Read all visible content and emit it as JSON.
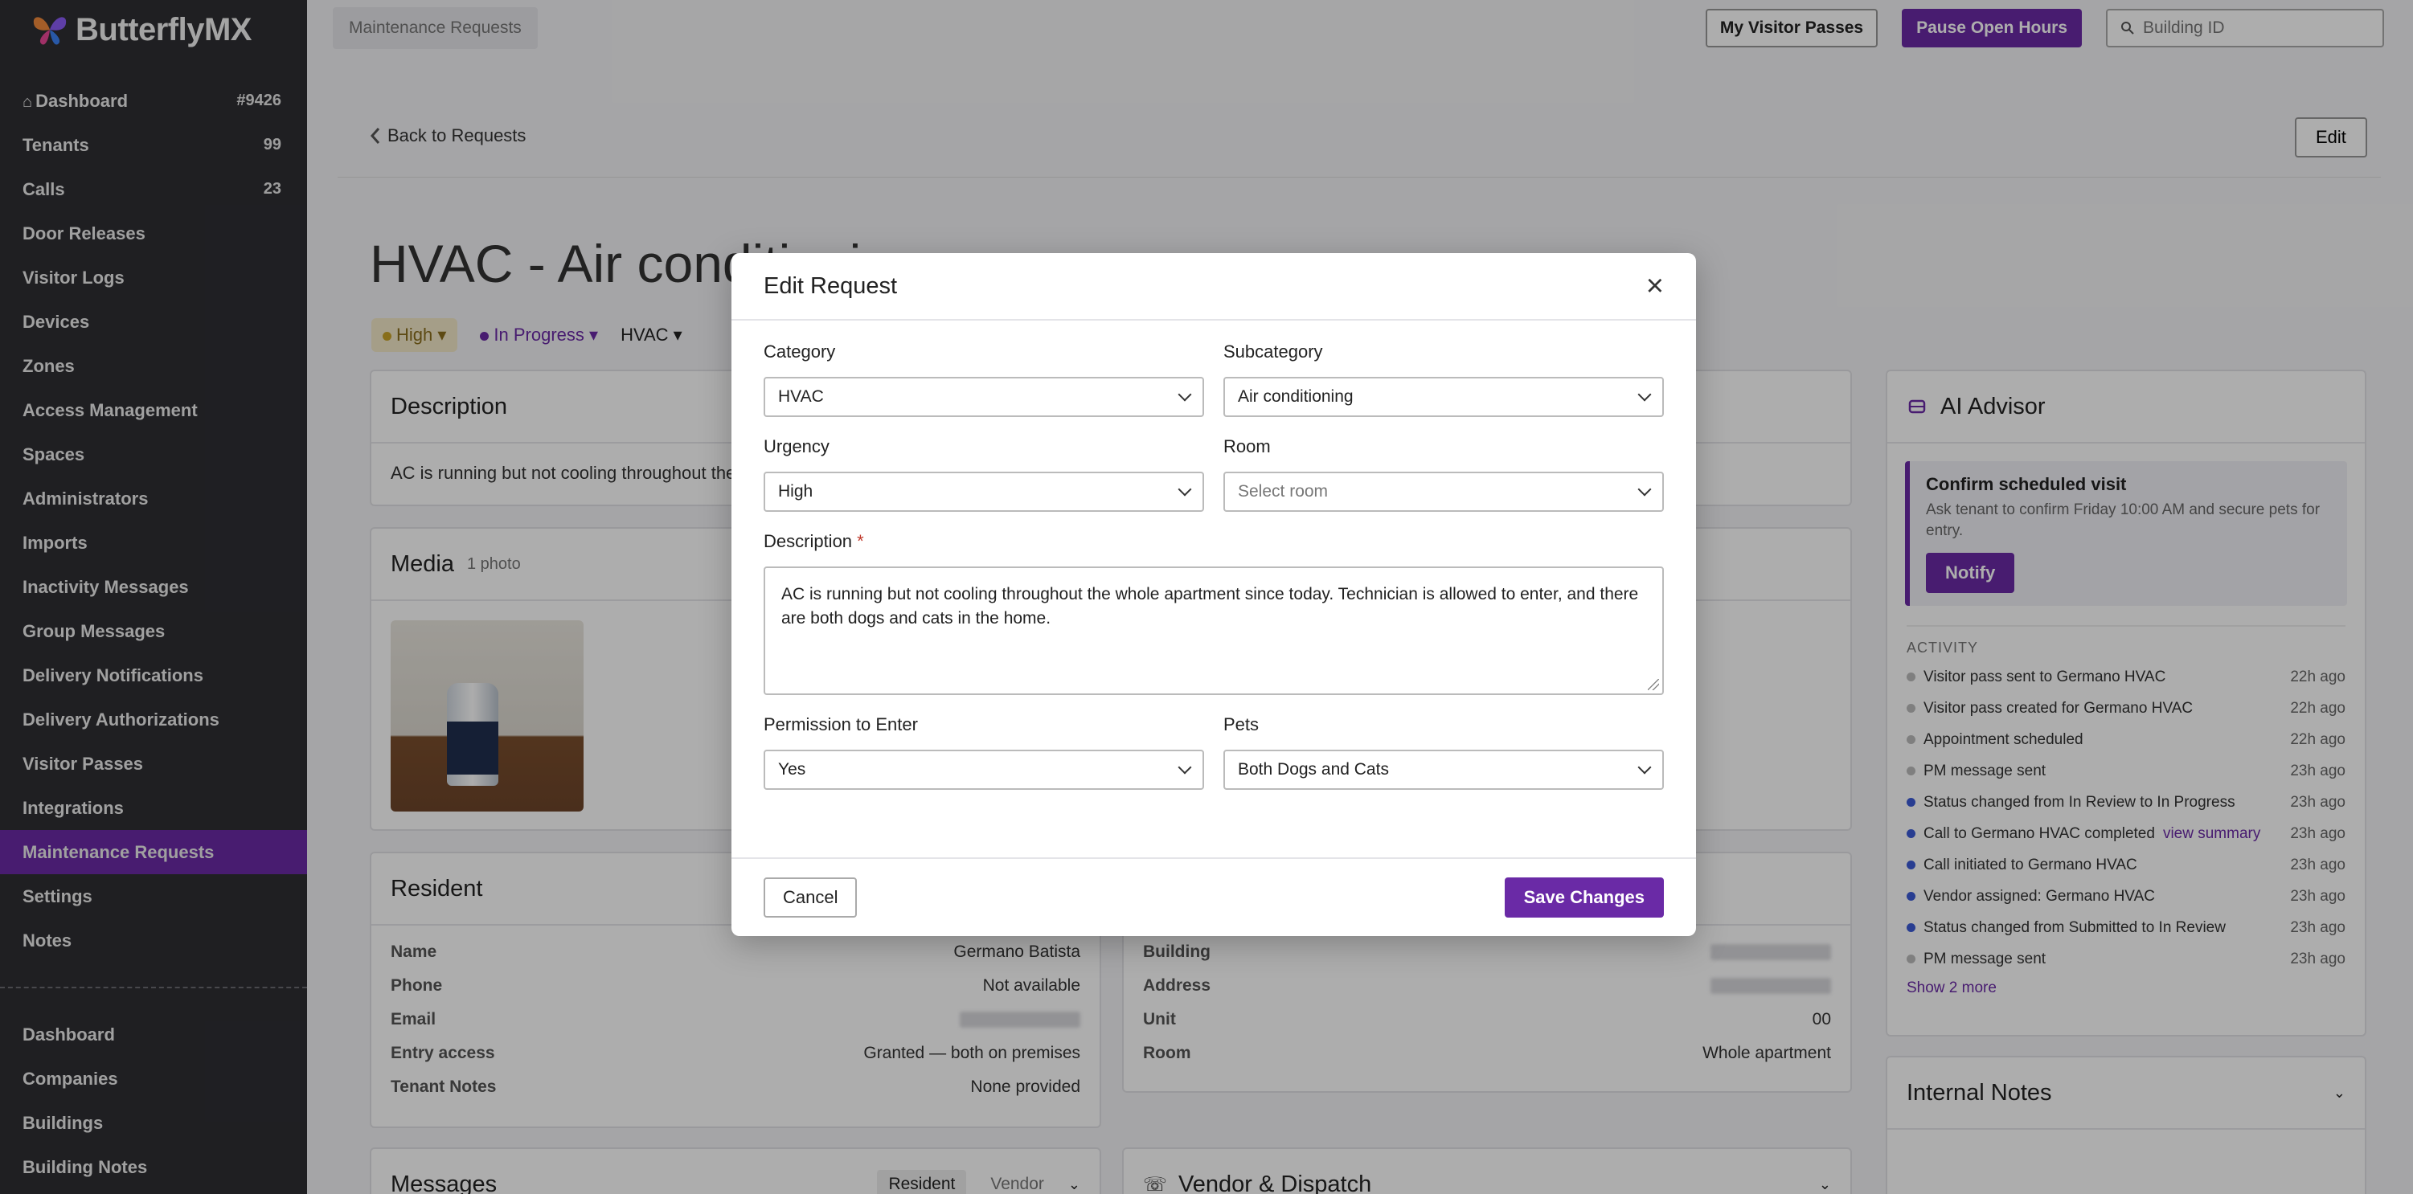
{
  "brand": {
    "name": "ButterflyMX",
    "accent": "#6a2aa6"
  },
  "sidebar": {
    "items": [
      {
        "label": "Dashboard",
        "count": "#9426",
        "icon": "home-icon"
      },
      {
        "label": "Tenants",
        "count": "99"
      },
      {
        "label": "Calls",
        "count": "23"
      },
      {
        "label": "Door Releases"
      },
      {
        "label": "Visitor Logs"
      },
      {
        "label": "Devices"
      },
      {
        "label": "Zones"
      },
      {
        "label": "Access Management"
      },
      {
        "label": "Spaces"
      },
      {
        "label": "Administrators"
      },
      {
        "label": "Imports"
      },
      {
        "label": "Inactivity Messages"
      },
      {
        "label": "Group Messages"
      },
      {
        "label": "Delivery Notifications"
      },
      {
        "label": "Delivery Authorizations"
      },
      {
        "label": "Visitor Passes"
      },
      {
        "label": "Integrations"
      },
      {
        "label": "Maintenance Requests",
        "active": true
      },
      {
        "label": "Settings"
      },
      {
        "label": "Notes"
      }
    ],
    "secondary": [
      {
        "label": "Dashboard"
      },
      {
        "label": "Companies"
      },
      {
        "label": "Buildings"
      },
      {
        "label": "Building Notes"
      }
    ]
  },
  "topbar": {
    "breadcrumb": "Maintenance Requests",
    "visitor_passes": "My Visitor Passes",
    "pause_hours": "Pause Open Hours",
    "search_placeholder": "Building ID"
  },
  "page": {
    "back": "Back to Requests",
    "edit": "Edit",
    "title": "HVAC - Air conditioning",
    "pill_urgency": "High",
    "pill_status": "In Progress",
    "pill_category": "HVAC",
    "description_title": "Description",
    "description_text": "AC is running but not cooling throughout the whole apartment since today.",
    "media_title": "Media",
    "media_count": "1 photo",
    "resident_title": "Resident",
    "resident": [
      {
        "k": "Name",
        "v": "Germano Batista"
      },
      {
        "k": "Phone",
        "v": "Not available"
      },
      {
        "k": "Email",
        "v": ""
      },
      {
        "k": "Entry access",
        "v": "Granted — both on premises"
      },
      {
        "k": "Tenant Notes",
        "v": "None provided"
      }
    ],
    "building": [
      {
        "k": "Building",
        "v": ""
      },
      {
        "k": "Address",
        "v": ""
      },
      {
        "k": "Unit",
        "v": "00"
      },
      {
        "k": "Room",
        "v": "Whole apartment"
      }
    ],
    "messages_title": "Messages",
    "messages_tab_resident": "Resident",
    "messages_tab_vendor": "Vendor",
    "vendor_title": "Vendor & Dispatch"
  },
  "ai": {
    "title": "AI Advisor",
    "tip_title": "Confirm scheduled visit",
    "tip_text": "Ask tenant to confirm Friday 10:00 AM and secure pets for entry.",
    "notify": "Notify",
    "activity_label": "ACTIVITY",
    "activity": [
      {
        "text": "Visitor pass sent to Germano HVAC",
        "time": "22h ago",
        "blue": false
      },
      {
        "text": "Visitor pass created for Germano HVAC",
        "time": "22h ago",
        "blue": false
      },
      {
        "text": "Appointment scheduled",
        "time": "22h ago",
        "blue": false
      },
      {
        "text": "PM message sent",
        "time": "23h ago",
        "blue": false
      },
      {
        "text": "Status changed from In Review to In Progress",
        "time": "23h ago",
        "blue": true
      },
      {
        "text": "Call to Germano HVAC completed",
        "link": "view summary",
        "time": "23h ago",
        "blue": true
      },
      {
        "text": "Call initiated to Germano HVAC",
        "time": "23h ago",
        "blue": true
      },
      {
        "text": "Vendor assigned: Germano HVAC",
        "time": "23h ago",
        "blue": true
      },
      {
        "text": "Status changed from Submitted to In Review",
        "time": "23h ago",
        "blue": true
      },
      {
        "text": "PM message sent",
        "time": "23h ago",
        "blue": false
      }
    ],
    "show_more": "Show 2 more",
    "internal_notes": "Internal Notes"
  },
  "modal": {
    "title": "Edit Request",
    "category_label": "Category",
    "category_value": "HVAC",
    "subcategory_label": "Subcategory",
    "subcategory_value": "Air conditioning",
    "urgency_label": "Urgency",
    "urgency_value": "High",
    "room_label": "Room",
    "room_placeholder": "Select room",
    "description_label": "Description",
    "description_required": "*",
    "description_value": "AC is running but not cooling throughout the whole apartment since today. Technician is allowed to enter, and there are both dogs and cats in the home.",
    "permission_label": "Permission to Enter",
    "permission_value": "Yes",
    "pets_label": "Pets",
    "pets_value": "Both Dogs and Cats",
    "cancel": "Cancel",
    "save": "Save Changes"
  }
}
